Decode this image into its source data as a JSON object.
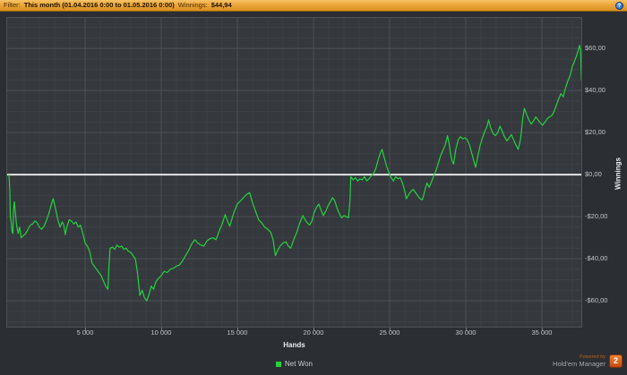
{
  "filter_bar": {
    "filter_label": "Filter:",
    "filter_value": "This month (01.04.2016 0:00 to 01.05.2016 0:00)",
    "winnings_label": "Winnings:",
    "winnings_value": "$44,94",
    "help_icon": "question-mark-circle-icon"
  },
  "chart_data": {
    "type": "line",
    "xlabel": "Hands",
    "ylabel": "Winnings",
    "x_ticks": [
      "5 000",
      "10 000",
      "15 000",
      "20 000",
      "25 000",
      "30 000",
      "35 000"
    ],
    "x_tick_values": [
      5000,
      10000,
      15000,
      20000,
      25000,
      30000,
      35000
    ],
    "y_ticks": [
      "$60,00",
      "$40,00",
      "$20,00",
      "$0,00",
      "-$20,00",
      "-$40,00",
      "-$60,00"
    ],
    "y_tick_values": [
      60,
      40,
      20,
      0,
      -20,
      -40,
      -60
    ],
    "xlim": [
      -118,
      37590
    ],
    "ylim": [
      -72.3,
      74.5
    ],
    "grid": {
      "x_minor_step": 1000,
      "x_major_step": 5000,
      "y_minor_step": 5,
      "y_major_step": 20
    },
    "zero_line": true,
    "legend_position": "bottom-center",
    "legend": [
      {
        "label": "Net Won",
        "color": "#24d23f"
      }
    ],
    "colors": {
      "plot_bg": "#35393d",
      "outer_bg": "#2b2e32",
      "grid_minor": "#3c4146",
      "grid_major": "#4a5055",
      "zero_line": "#e4e4e4",
      "line": "#24d23f"
    },
    "series": [
      {
        "name": "Net Won",
        "color": "#24d23f",
        "points": [
          [
            0,
            0
          ],
          [
            60,
            -8
          ],
          [
            90,
            -20
          ],
          [
            150,
            -23
          ],
          [
            200,
            -27
          ],
          [
            260,
            -28
          ],
          [
            300,
            -17
          ],
          [
            360,
            -13
          ],
          [
            420,
            -18
          ],
          [
            500,
            -24
          ],
          [
            600,
            -28
          ],
          [
            700,
            -25
          ],
          [
            800,
            -30
          ],
          [
            950,
            -29
          ],
          [
            1100,
            -28
          ],
          [
            1250,
            -26
          ],
          [
            1400,
            -24
          ],
          [
            1550,
            -23.5
          ],
          [
            1700,
            -22
          ],
          [
            1850,
            -23
          ],
          [
            2000,
            -25
          ],
          [
            2150,
            -26
          ],
          [
            2300,
            -24.5
          ],
          [
            2450,
            -22
          ],
          [
            2600,
            -19
          ],
          [
            2750,
            -15
          ],
          [
            2900,
            -11.5
          ],
          [
            3050,
            -16
          ],
          [
            3200,
            -21
          ],
          [
            3350,
            -25
          ],
          [
            3500,
            -22.5
          ],
          [
            3600,
            -24
          ],
          [
            3700,
            -28.5
          ],
          [
            3800,
            -25
          ],
          [
            3950,
            -21.5
          ],
          [
            4100,
            -22
          ],
          [
            4250,
            -23.5
          ],
          [
            4400,
            -22.5
          ],
          [
            4550,
            -25
          ],
          [
            4700,
            -24
          ],
          [
            4850,
            -28
          ],
          [
            5000,
            -32.5
          ],
          [
            5150,
            -34
          ],
          [
            5300,
            -36.5
          ],
          [
            5450,
            -42
          ],
          [
            5600,
            -43.5
          ],
          [
            5750,
            -45
          ],
          [
            5900,
            -46.5
          ],
          [
            6050,
            -48
          ],
          [
            6200,
            -50.5
          ],
          [
            6350,
            -53
          ],
          [
            6500,
            -54.5
          ],
          [
            6570,
            -43
          ],
          [
            6640,
            -35
          ],
          [
            6800,
            -34.5
          ],
          [
            6950,
            -35.5
          ],
          [
            7100,
            -33.5
          ],
          [
            7250,
            -34.5
          ],
          [
            7400,
            -34
          ],
          [
            7550,
            -35.5
          ],
          [
            7700,
            -35
          ],
          [
            7850,
            -36.5
          ],
          [
            8000,
            -37
          ],
          [
            8150,
            -38.5
          ],
          [
            8300,
            -40
          ],
          [
            8450,
            -47
          ],
          [
            8600,
            -57.5
          ],
          [
            8750,
            -55
          ],
          [
            8900,
            -58.5
          ],
          [
            9050,
            -60
          ],
          [
            9200,
            -57
          ],
          [
            9350,
            -53
          ],
          [
            9500,
            -54.5
          ],
          [
            9650,
            -51
          ],
          [
            9800,
            -49.5
          ],
          [
            10000,
            -48
          ],
          [
            10200,
            -46
          ],
          [
            10400,
            -46.5
          ],
          [
            10600,
            -45
          ],
          [
            10800,
            -44.5
          ],
          [
            11000,
            -43.5
          ],
          [
            11200,
            -43
          ],
          [
            11400,
            -41
          ],
          [
            11600,
            -38.5
          ],
          [
            11800,
            -36
          ],
          [
            12000,
            -33
          ],
          [
            12200,
            -31
          ],
          [
            12400,
            -32.5
          ],
          [
            12600,
            -33.5
          ],
          [
            12800,
            -34
          ],
          [
            13000,
            -31.5
          ],
          [
            13200,
            -30.5
          ],
          [
            13400,
            -30
          ],
          [
            13600,
            -31
          ],
          [
            13800,
            -27
          ],
          [
            14000,
            -23.5
          ],
          [
            14200,
            -19
          ],
          [
            14350,
            -22
          ],
          [
            14500,
            -24.5
          ],
          [
            14650,
            -21
          ],
          [
            14800,
            -17.5
          ],
          [
            15000,
            -14
          ],
          [
            15200,
            -12.5
          ],
          [
            15400,
            -11
          ],
          [
            15600,
            -9.5
          ],
          [
            15800,
            -8.5
          ],
          [
            16000,
            -13.5
          ],
          [
            16200,
            -17.5
          ],
          [
            16400,
            -21.5
          ],
          [
            16600,
            -23
          ],
          [
            16800,
            -25
          ],
          [
            17000,
            -26
          ],
          [
            17200,
            -27.5
          ],
          [
            17350,
            -31
          ],
          [
            17500,
            -38.5
          ],
          [
            17650,
            -36
          ],
          [
            17800,
            -34
          ],
          [
            18000,
            -32.5
          ],
          [
            18200,
            -32
          ],
          [
            18350,
            -34
          ],
          [
            18500,
            -35
          ],
          [
            18700,
            -31
          ],
          [
            18900,
            -27.5
          ],
          [
            19100,
            -23
          ],
          [
            19300,
            -19.5
          ],
          [
            19450,
            -21.5
          ],
          [
            19600,
            -23
          ],
          [
            19750,
            -24
          ],
          [
            19900,
            -22
          ],
          [
            20050,
            -18
          ],
          [
            20200,
            -15.5
          ],
          [
            20350,
            -14
          ],
          [
            20500,
            -17
          ],
          [
            20650,
            -19.5
          ],
          [
            20800,
            -17.5
          ],
          [
            20950,
            -15
          ],
          [
            21100,
            -13
          ],
          [
            21250,
            -11
          ],
          [
            21400,
            -12.5
          ],
          [
            21550,
            -16
          ],
          [
            21700,
            -18.5
          ],
          [
            21850,
            -20.5
          ],
          [
            22000,
            -19.5
          ],
          [
            22150,
            -20
          ],
          [
            22300,
            -20.5
          ],
          [
            22400,
            -12
          ],
          [
            22450,
            -1
          ],
          [
            22600,
            -2.5
          ],
          [
            22750,
            -1.5
          ],
          [
            22900,
            -3
          ],
          [
            23050,
            -2
          ],
          [
            23200,
            -2.5
          ],
          [
            23350,
            -1
          ],
          [
            23500,
            -3
          ],
          [
            23650,
            -2
          ],
          [
            23800,
            -0.5
          ],
          [
            23950,
            0.5
          ],
          [
            24100,
            3
          ],
          [
            24250,
            7
          ],
          [
            24400,
            10.5
          ],
          [
            24500,
            12
          ],
          [
            24650,
            8
          ],
          [
            24800,
            4
          ],
          [
            24950,
            1
          ],
          [
            25100,
            -1.5
          ],
          [
            25250,
            -3
          ],
          [
            25400,
            -1
          ],
          [
            25550,
            -2
          ],
          [
            25700,
            -1.5
          ],
          [
            25850,
            -4
          ],
          [
            26000,
            -8
          ],
          [
            26100,
            -11.5
          ],
          [
            26250,
            -9.5
          ],
          [
            26400,
            -8
          ],
          [
            26550,
            -7
          ],
          [
            26700,
            -8.5
          ],
          [
            26850,
            -10
          ],
          [
            27000,
            -11.5
          ],
          [
            27150,
            -12
          ],
          [
            27300,
            -8
          ],
          [
            27450,
            -4
          ],
          [
            27600,
            -6
          ],
          [
            27750,
            -3.5
          ],
          [
            27900,
            -0.5
          ],
          [
            28050,
            2
          ],
          [
            28200,
            5.5
          ],
          [
            28350,
            9
          ],
          [
            28500,
            11.5
          ],
          [
            28650,
            14
          ],
          [
            28800,
            18.5
          ],
          [
            28900,
            15
          ],
          [
            29000,
            10
          ],
          [
            29100,
            6.5
          ],
          [
            29200,
            5
          ],
          [
            29350,
            12
          ],
          [
            29500,
            16.5
          ],
          [
            29650,
            18
          ],
          [
            29800,
            17
          ],
          [
            29950,
            17.5
          ],
          [
            30100,
            16.5
          ],
          [
            30250,
            14
          ],
          [
            30400,
            10
          ],
          [
            30550,
            6
          ],
          [
            30650,
            3.5
          ],
          [
            30800,
            9
          ],
          [
            30950,
            14
          ],
          [
            31100,
            17.5
          ],
          [
            31250,
            20.5
          ],
          [
            31400,
            23
          ],
          [
            31500,
            26
          ],
          [
            31650,
            22
          ],
          [
            31800,
            19.5
          ],
          [
            31950,
            18.5
          ],
          [
            32100,
            20
          ],
          [
            32250,
            23
          ],
          [
            32400,
            20.5
          ],
          [
            32550,
            18
          ],
          [
            32700,
            16
          ],
          [
            32850,
            17.5
          ],
          [
            33000,
            19
          ],
          [
            33150,
            16.5
          ],
          [
            33300,
            14
          ],
          [
            33450,
            12
          ],
          [
            33600,
            17
          ],
          [
            33750,
            27
          ],
          [
            33850,
            31.5
          ],
          [
            34000,
            28.5
          ],
          [
            34150,
            26
          ],
          [
            34300,
            24
          ],
          [
            34450,
            25.5
          ],
          [
            34600,
            27.5
          ],
          [
            34750,
            26
          ],
          [
            34900,
            24.5
          ],
          [
            35050,
            23.5
          ],
          [
            35200,
            25
          ],
          [
            35350,
            26.5
          ],
          [
            35500,
            27.5
          ],
          [
            35650,
            28
          ],
          [
            35800,
            30
          ],
          [
            35950,
            33
          ],
          [
            36100,
            36
          ],
          [
            36250,
            38.5
          ],
          [
            36400,
            37
          ],
          [
            36550,
            41
          ],
          [
            36700,
            44.5
          ],
          [
            36850,
            47
          ],
          [
            37000,
            51.5
          ],
          [
            37150,
            54
          ],
          [
            37300,
            57
          ],
          [
            37400,
            59.5
          ],
          [
            37480,
            61.5
          ],
          [
            37540,
            59
          ],
          [
            37600,
            44.94
          ]
        ]
      }
    ]
  },
  "footer": {
    "powered_by": "Powered by",
    "brand": "Hold'em Manager",
    "brand_badge": "2"
  }
}
